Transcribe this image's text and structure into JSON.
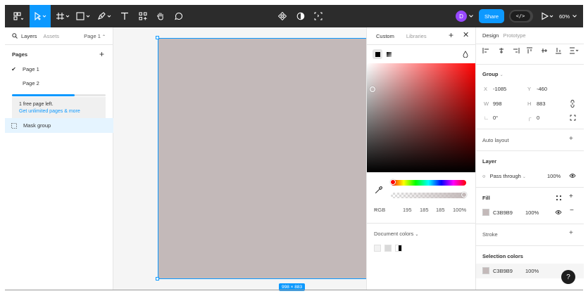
{
  "toolbar": {
    "share_label": "Share",
    "avatar_initial": "D",
    "dev_label": "</>",
    "zoom": "60%"
  },
  "left_panel": {
    "tabs": {
      "layers": "Layers",
      "assets": "Assets"
    },
    "page_select": "Page 1",
    "pages_title": "Pages",
    "pages": [
      {
        "label": "Page 1",
        "active": true
      },
      {
        "label": "Page 2",
        "active": false
      }
    ],
    "pages_used_fraction": 0.67,
    "free_notice": "1 free page left.",
    "upgrade_link": "Get unlimited pages & more",
    "layers": [
      {
        "label": "Mask group"
      }
    ]
  },
  "canvas": {
    "frame_color": "#C3B9B9",
    "size_badge": "998 × 883"
  },
  "color_picker": {
    "tabs": {
      "custom": "Custom",
      "libraries": "Libraries"
    },
    "mode": "RGB",
    "r": "195",
    "g": "185",
    "b": "185",
    "alpha": "100%",
    "document_colors_label": "Document colors",
    "document_colors": [
      "#f2f2f2",
      "#d9d9d9",
      "#000000"
    ]
  },
  "right_panel": {
    "tabs": {
      "design": "Design",
      "prototype": "Prototype"
    },
    "group_title": "Group",
    "x_label": "X",
    "x_value": "-1085",
    "y_label": "Y",
    "y_value": "-460",
    "w_label": "W",
    "w_value": "998",
    "h_label": "H",
    "h_value": "883",
    "rotation": "0°",
    "radius": "0",
    "auto_layout": "Auto layout",
    "layer_title": "Layer",
    "blend_mode": "Pass through",
    "layer_opacity": "100%",
    "fill_title": "Fill",
    "fill_hex": "C3B9B9",
    "fill_opacity": "100%",
    "stroke_title": "Stroke",
    "selection_colors_title": "Selection colors",
    "selection_hex": "C3B9B9",
    "selection_opacity": "100%"
  },
  "help": "?"
}
